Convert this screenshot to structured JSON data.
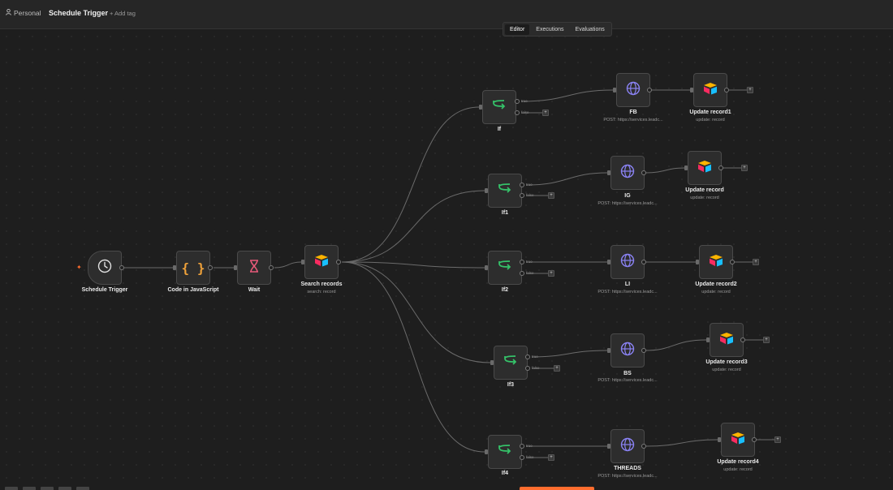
{
  "header": {
    "workspace": "Personal",
    "workflow_name": "Schedule Trigger",
    "add_tag": "+ Add tag"
  },
  "tabs": [
    {
      "label": "Editor",
      "active": true
    },
    {
      "label": "Executions",
      "active": false
    },
    {
      "label": "Evaluations",
      "active": false
    }
  ],
  "nodes": {
    "schedule_trigger": {
      "label": "Schedule Trigger",
      "icon": "clock-icon"
    },
    "code": {
      "label": "Code in JavaScript",
      "icon": "code-braces-icon"
    },
    "wait": {
      "label": "Wait",
      "icon": "hourglass-icon"
    },
    "search": {
      "label": "Search records",
      "sub": "search: record",
      "icon": "airtable-icon"
    },
    "ifs": [
      {
        "label": "If",
        "true_label": "true",
        "false_label": "false"
      },
      {
        "label": "If1",
        "true_label": "true",
        "false_label": "false"
      },
      {
        "label": "If2",
        "true_label": "true",
        "false_label": "false"
      },
      {
        "label": "If3",
        "true_label": "true",
        "false_label": "false"
      },
      {
        "label": "If4",
        "true_label": "true",
        "false_label": "false"
      }
    ],
    "http": [
      {
        "label": "FB",
        "sub": "POST: https://services.leadc..."
      },
      {
        "label": "IG",
        "sub": "POST: https://services.leadc..."
      },
      {
        "label": "LI",
        "sub": "POST: https://services.leadc..."
      },
      {
        "label": "BS",
        "sub": "POST: https://services.leadc..."
      },
      {
        "label": "THREADS",
        "sub": "POST: https://services.leadc..."
      }
    ],
    "updates": [
      {
        "label": "Update record1",
        "sub": "update: record"
      },
      {
        "label": "Update record",
        "sub": "update: record"
      },
      {
        "label": "Update record2",
        "sub": "update: record"
      },
      {
        "label": "Update record3",
        "sub": "update: record"
      },
      {
        "label": "Update record4",
        "sub": "update: record"
      }
    ]
  },
  "colors": {
    "accent": "#ff6d2e",
    "if_icon": "#35c46a",
    "http_icon": "#8b83f5",
    "code_icon": "#f0a23a",
    "wait_icon": "#e85a7a"
  }
}
